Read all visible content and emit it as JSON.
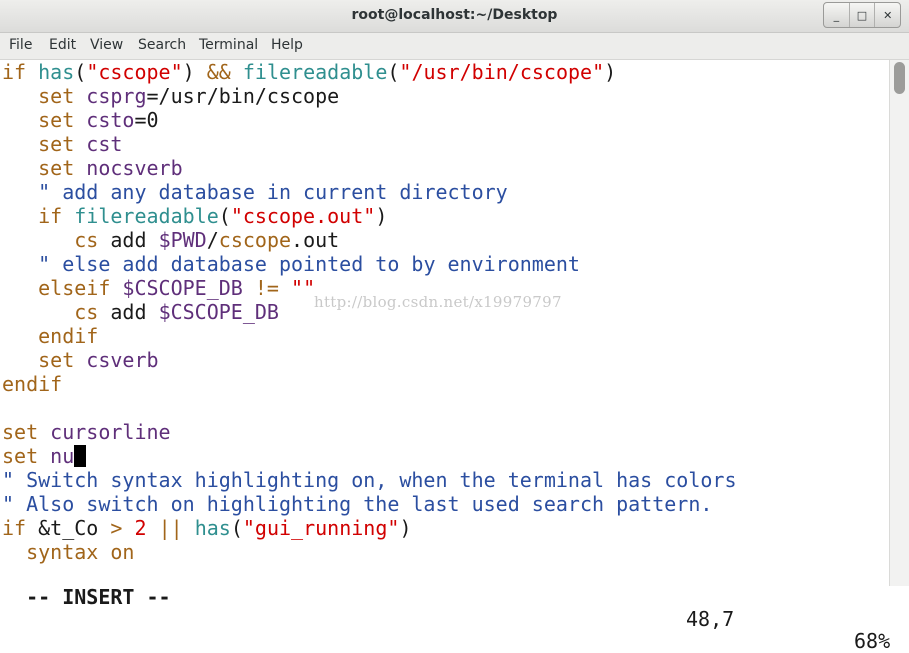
{
  "window": {
    "title": "root@localhost:~/Desktop",
    "controls": [
      "_",
      "□",
      "✕"
    ]
  },
  "menu": [
    "File",
    "Edit",
    "View",
    "Search",
    "Terminal",
    "Help"
  ],
  "editor": {
    "lines": [
      [
        [
          "kw",
          "if"
        ],
        [
          "pl",
          " "
        ],
        [
          "fn",
          "has"
        ],
        [
          "pl",
          "("
        ],
        [
          "str",
          "\"cscope\""
        ],
        [
          "pl",
          ") "
        ],
        [
          "kw",
          "&&"
        ],
        [
          "pl",
          " "
        ],
        [
          "fn",
          "filereadable"
        ],
        [
          "pl",
          "("
        ],
        [
          "str",
          "\"/usr/bin/cscope\""
        ],
        [
          "pl",
          ")"
        ]
      ],
      [
        [
          "pl",
          "   "
        ],
        [
          "kw",
          "set"
        ],
        [
          "pl",
          " "
        ],
        [
          "opt",
          "csprg"
        ],
        [
          "pl",
          "=/usr/bin/cscope"
        ]
      ],
      [
        [
          "pl",
          "   "
        ],
        [
          "kw",
          "set"
        ],
        [
          "pl",
          " "
        ],
        [
          "opt",
          "csto"
        ],
        [
          "pl",
          "=0"
        ]
      ],
      [
        [
          "pl",
          "   "
        ],
        [
          "kw",
          "set"
        ],
        [
          "pl",
          " "
        ],
        [
          "opt",
          "cst"
        ]
      ],
      [
        [
          "pl",
          "   "
        ],
        [
          "kw",
          "set"
        ],
        [
          "pl",
          " "
        ],
        [
          "opt",
          "nocsverb"
        ]
      ],
      [
        [
          "pl",
          "   "
        ],
        [
          "cmt",
          "\" add any database in current directory"
        ]
      ],
      [
        [
          "pl",
          "   "
        ],
        [
          "kw",
          "if"
        ],
        [
          "pl",
          " "
        ],
        [
          "fn",
          "filereadable"
        ],
        [
          "pl",
          "("
        ],
        [
          "str",
          "\"cscope.out\""
        ],
        [
          "pl",
          ")"
        ]
      ],
      [
        [
          "pl",
          "      "
        ],
        [
          "kw",
          "cs"
        ],
        [
          "pl",
          " add "
        ],
        [
          "opt",
          "$PWD"
        ],
        [
          "pl",
          "/"
        ],
        [
          "kw",
          "cscope"
        ],
        [
          "pl",
          "."
        ],
        [
          "pl",
          "out"
        ]
      ],
      [
        [
          "pl",
          "   "
        ],
        [
          "cmt",
          "\" else add database pointed to by environment"
        ]
      ],
      [
        [
          "pl",
          "   "
        ],
        [
          "kw",
          "elseif"
        ],
        [
          "pl",
          " "
        ],
        [
          "opt",
          "$CSCOPE_DB"
        ],
        [
          "pl",
          " "
        ],
        [
          "kw",
          "!="
        ],
        [
          "pl",
          " "
        ],
        [
          "str",
          "\"\""
        ]
      ],
      [
        [
          "pl",
          "      "
        ],
        [
          "kw",
          "cs"
        ],
        [
          "pl",
          " add "
        ],
        [
          "opt",
          "$CSCOPE_DB"
        ]
      ],
      [
        [
          "pl",
          "   "
        ],
        [
          "kw",
          "endif"
        ]
      ],
      [
        [
          "pl",
          "   "
        ],
        [
          "kw",
          "set"
        ],
        [
          "pl",
          " "
        ],
        [
          "opt",
          "csverb"
        ]
      ],
      [
        [
          "kw",
          "endif"
        ]
      ],
      [],
      [
        [
          "kw",
          "set"
        ],
        [
          "pl",
          " "
        ],
        [
          "opt",
          "cursorline"
        ]
      ],
      [
        [
          "kw",
          "set"
        ],
        [
          "pl",
          " "
        ],
        [
          "opt",
          "nu"
        ],
        [
          "cursor",
          ""
        ]
      ],
      [
        [
          "cmt",
          "\" Switch syntax highlighting on, when the terminal has colors"
        ]
      ],
      [
        [
          "cmt",
          "\" Also switch on highlighting the last used search pattern."
        ]
      ],
      [
        [
          "kw",
          "if"
        ],
        [
          "pl",
          " &t_Co "
        ],
        [
          "kw",
          ">"
        ],
        [
          "pl",
          " "
        ],
        [
          "num",
          "2"
        ],
        [
          "pl",
          " "
        ],
        [
          "kw",
          "||"
        ],
        [
          "pl",
          " "
        ],
        [
          "fn",
          "has"
        ],
        [
          "pl",
          "("
        ],
        [
          "str",
          "\"gui_running\""
        ],
        [
          "pl",
          ")"
        ]
      ],
      [
        [
          "pl",
          "  "
        ],
        [
          "kw",
          "syntax"
        ],
        [
          "pl",
          " "
        ],
        [
          "kw",
          "on"
        ]
      ]
    ]
  },
  "watermark": "http://blog.csdn.net/x19979797",
  "status": {
    "mode": "-- INSERT --",
    "position": "48,7",
    "percent": "68%"
  },
  "scrollbar": {
    "thumb_start": 0.0,
    "thumb_end": 0.06
  },
  "colors": {
    "keyword": "#a1651a",
    "function": "#2f8f8f",
    "string": "#d10000",
    "option": "#5f2f7a",
    "comment": "#2b4ea0"
  }
}
